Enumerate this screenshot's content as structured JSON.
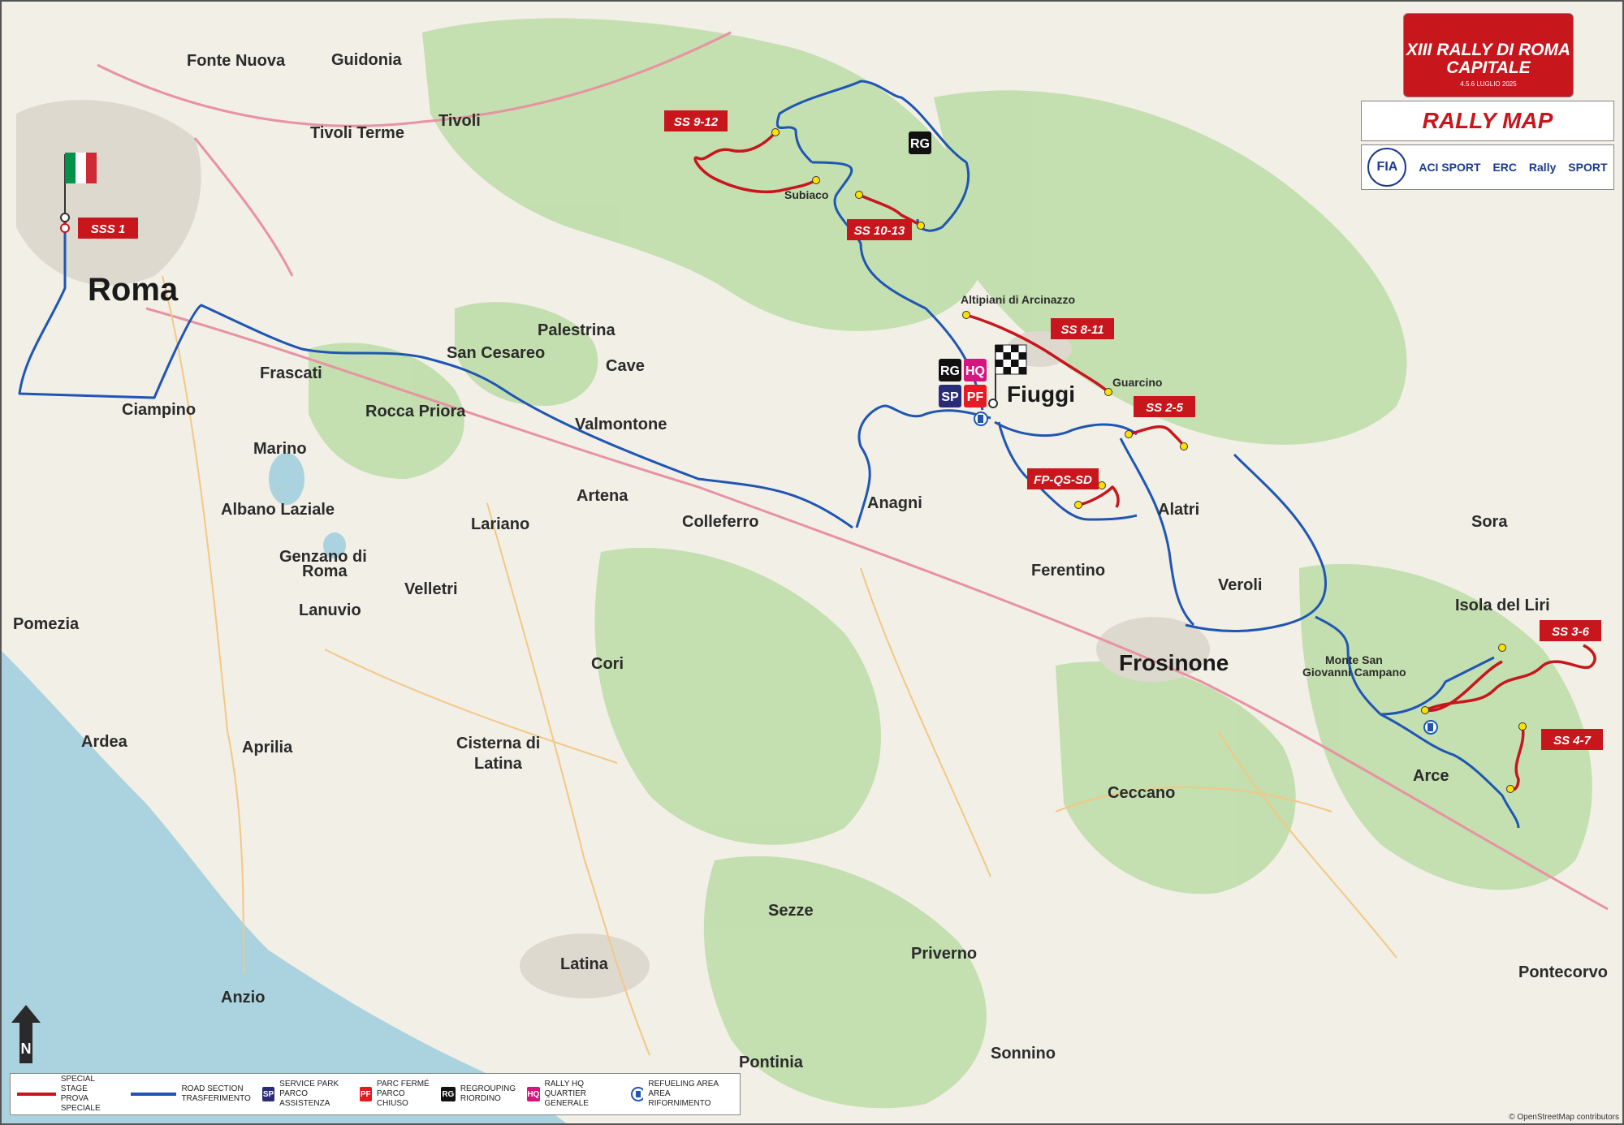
{
  "header": {
    "event_title_line1": "XIII RALLY DI ROMA",
    "event_title_line2": "CAPITALE",
    "event_dates": "4.5.6 LUGLIO 2025",
    "map_title": "RALLY MAP",
    "sponsors": [
      "FIA",
      "ACI SPORT",
      "ERC",
      "Rally",
      "SPORT"
    ]
  },
  "towns": {
    "roma": "Roma",
    "fonte_nuova": "Fonte Nuova",
    "guidonia": "Guidonia",
    "tivoli": "Tivoli",
    "tivoli_terme": "Tivoli Terme",
    "subiaco": "Subiaco",
    "altipiani": "Altipiani di Arcinazzo",
    "guarcino": "Guarcino",
    "fiuggi": "Fiuggi",
    "palestrina": "Palestrina",
    "san_cesareo": "San Cesareo",
    "cave": "Cave",
    "frascati": "Frascati",
    "ciampino": "Ciampino",
    "rocca_priora": "Rocca Priora",
    "valmontone": "Valmontone",
    "marino": "Marino",
    "albano": "Albano Laziale",
    "genzano_1": "Genzano di",
    "genzano_2": "Roma",
    "lanuvio": "Lanuvio",
    "velletri": "Velletri",
    "lariano": "Lariano",
    "artena": "Artena",
    "colleferro": "Colleferro",
    "anagni": "Anagni",
    "alatri": "Alatri",
    "ferentino": "Ferentino",
    "veroli": "Veroli",
    "frosinone": "Frosinone",
    "sora": "Sora",
    "isola_del_liri": "Isola del Liri",
    "monte_san_1": "Monte San",
    "monte_san_2": "Giovanni Campano",
    "arce": "Arce",
    "ceccano": "Ceccano",
    "pomezia": "Pomezia",
    "ardea": "Ardea",
    "aprilia": "Aprilia",
    "cori": "Cori",
    "cisterna_1": "Cisterna di",
    "cisterna_2": "Latina",
    "sezze": "Sezze",
    "priverno": "Priverno",
    "latina": "Latina",
    "anzio": "Anzio",
    "pontinia": "Pontinia",
    "sonnino": "Sonnino",
    "pontecorvo": "Pontecorvo"
  },
  "stages": {
    "sss1": "SSS 1",
    "ss9_12": "SS 9-12",
    "ss10_13": "SS 10-13",
    "ss8_11": "SS 8-11",
    "ss2_5": "SS 2-5",
    "fp": "FP-QS-SD",
    "ss3_6": "SS 3-6",
    "ss4_7": "SS 4-7"
  },
  "markers": {
    "rg": "RG",
    "hq": "HQ",
    "sp": "SP",
    "pf": "PF",
    "north": "N"
  },
  "legend": [
    {
      "line1": "SPECIAL STAGE",
      "line2": "PROVA SPECIALE",
      "kind": "red-line"
    },
    {
      "line1": "ROAD SECTION",
      "line2": "TRASFERIMENTO",
      "kind": "blue-line"
    },
    {
      "line1": "SERVICE PARK",
      "line2": "PARCO ASSISTENZA",
      "kind": "SP"
    },
    {
      "line1": "PARC FERMÉ",
      "line2": "PARCO CHIUSO",
      "kind": "PF"
    },
    {
      "line1": "REGROUPING",
      "line2": "RIORDINO",
      "kind": "RG"
    },
    {
      "line1": "RALLY HQ",
      "line2": "QUARTIER GENERALE",
      "kind": "HQ"
    },
    {
      "line1": "REFUELING AREA",
      "line2": "AREA RIFORNIMENTO",
      "kind": "fuel"
    }
  ],
  "credit": "© OpenStreetMap contributors",
  "colors": {
    "stage_red": "#c8161d",
    "road_blue": "#1f56b3",
    "hq_pink": "#d6157e",
    "sp_navy": "#2a2c7a",
    "rg_black": "#111111",
    "sea": "#aad3df",
    "forest": "#b9d9a4"
  }
}
